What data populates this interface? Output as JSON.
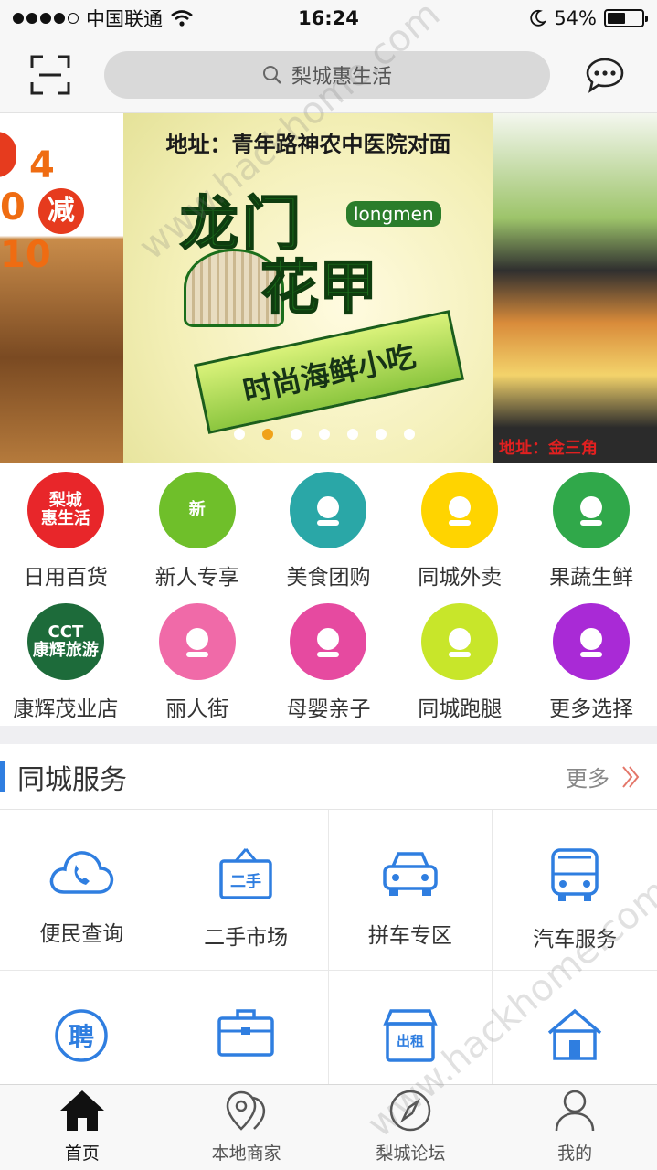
{
  "status": {
    "carrier": "中国联通",
    "time": "16:24",
    "battery": "54%",
    "battery_level": 0.54
  },
  "header": {
    "search_placeholder": "梨城惠生活"
  },
  "banner": {
    "left_promo_top": "4",
    "left_promo_prefix": "0",
    "left_promo_jian": "减",
    "left_promo_num": "10",
    "address": "地址：青年路神农中医院对面",
    "logo_line1": "龙门",
    "logo_line2": "花甲",
    "logo_en": "longmen",
    "tagline": "时尚海鲜小吃",
    "right_address": "地址：金三角",
    "slide_count": 7,
    "active_slide": 2
  },
  "categories": [
    {
      "label": "日用百货",
      "icon": "daily-goods-icon",
      "color": "#e8262a",
      "text": "梨城\n惠生活"
    },
    {
      "label": "新人专享",
      "icon": "newcomer-icon",
      "color": "#6fbf2a",
      "text": "新"
    },
    {
      "label": "美食团购",
      "icon": "chef-icon",
      "color": "#2aa7a7",
      "text": ""
    },
    {
      "label": "同城外卖",
      "icon": "delivery-icon",
      "color": "#ffd400",
      "text": ""
    },
    {
      "label": "果蔬生鲜",
      "icon": "produce-icon",
      "color": "#30a84a",
      "text": ""
    },
    {
      "label": "康辉茂业店",
      "icon": "cct-logo-icon",
      "color": "#1d6b3a",
      "text": "CCT\n康辉旅游"
    },
    {
      "label": "丽人街",
      "icon": "beauty-icon",
      "color": "#f06aa8",
      "text": ""
    },
    {
      "label": "母婴亲子",
      "icon": "mother-baby-icon",
      "color": "#e64aa0",
      "text": ""
    },
    {
      "label": "同城跑腿",
      "icon": "runner-icon",
      "color": "#c8e62a",
      "text": ""
    },
    {
      "label": "更多选择",
      "icon": "more-options-icon",
      "color": "#a92ad6",
      "text": ""
    }
  ],
  "services": {
    "title": "同城服务",
    "more": "更多",
    "items": [
      {
        "label": "便民查询",
        "icon": "phone-cloud-icon"
      },
      {
        "label": "二手市场",
        "icon": "secondhand-sign-icon",
        "sign": "二手"
      },
      {
        "label": "拼车专区",
        "icon": "car-icon"
      },
      {
        "label": "汽车服务",
        "icon": "bus-icon"
      },
      {
        "label": "",
        "icon": "recruit-icon",
        "sign": "聘"
      },
      {
        "label": "",
        "icon": "briefcase-icon"
      },
      {
        "label": "",
        "icon": "rental-shop-icon",
        "sign": "出租"
      },
      {
        "label": "",
        "icon": "house-icon"
      }
    ],
    "accent": "#2f7ee0"
  },
  "tabs": [
    {
      "label": "首页",
      "icon": "home-icon",
      "active": true
    },
    {
      "label": "本地商家",
      "icon": "location-pin-icon",
      "active": false
    },
    {
      "label": "梨城论坛",
      "icon": "compass-icon",
      "active": false
    },
    {
      "label": "我的",
      "icon": "person-icon",
      "active": false
    }
  ],
  "watermark": "www.hackhome.com"
}
